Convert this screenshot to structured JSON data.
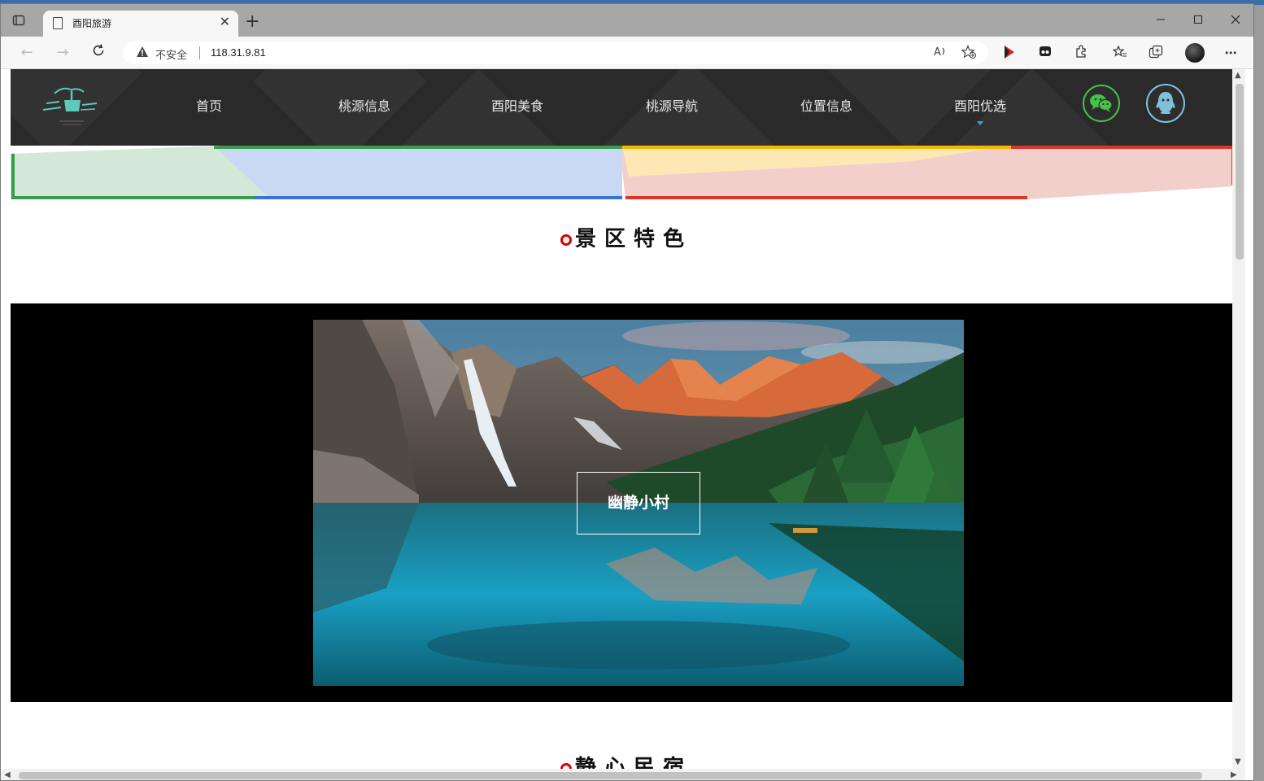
{
  "browser": {
    "tab_title": "酉阳旅游",
    "insecure_label": "不安全",
    "url": "118.31.9.81",
    "new_tab_symbol": "+",
    "tab_close_symbol": "✕"
  },
  "site": {
    "nav": [
      "首页",
      "桃源信息",
      "酉阳美食",
      "桃源导航",
      "位置信息",
      "酉阳优选"
    ],
    "active_nav_index": 5,
    "social": [
      "wechat-icon",
      "qq-icon"
    ]
  },
  "sections": {
    "features_title": "景区特色",
    "gallery_caption": "幽静小村",
    "next_title": "静心民宿"
  },
  "colors": {
    "header_bg": "#2a2a2a",
    "green": "#3a9a4e",
    "blue": "#3b74d9",
    "yellow": "#f5b800",
    "red": "#d9372b",
    "wechat": "#45c24a",
    "qq": "#7fc0d8",
    "title_dot": "#dd0000"
  }
}
